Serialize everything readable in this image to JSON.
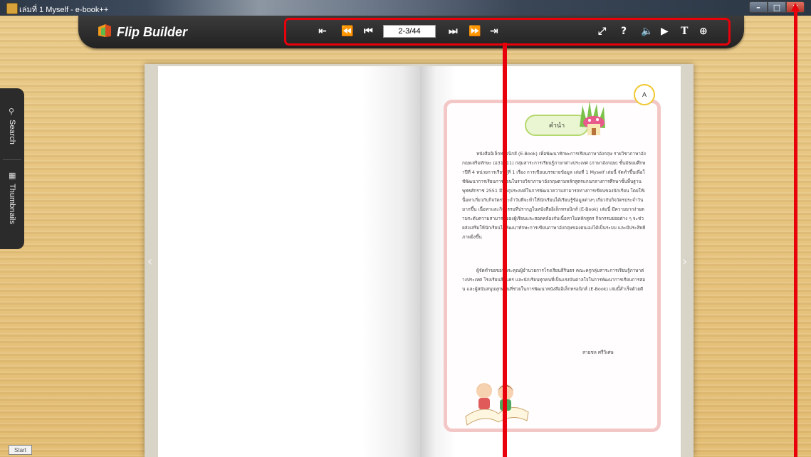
{
  "window": {
    "title": "เล่มที่ 1 Myself - e-book++",
    "minimize_label": "–",
    "maximize_label": "□",
    "close_label": "✕"
  },
  "toolbar": {
    "brand": "Flip Builder",
    "page_value": "2-3/44",
    "left_icons": [
      "first-page-icon",
      "previous-page-icon",
      "back-icon"
    ],
    "right_icons": [
      "forward-icon",
      "next-page-icon",
      "last-page-icon"
    ],
    "tool_icons": [
      "fullscreen-icon",
      "help-icon",
      "sound-icon",
      "autoplay-icon",
      "text-icon",
      "zoom-icon"
    ]
  },
  "side_tabs": {
    "search": "Search",
    "thumbnails": "Thumbnails"
  },
  "book": {
    "heading": "คำนำ",
    "badge": "A",
    "paragraph1": "หนังสืออิเล็กทรอนิกส์ (E-Book) เพื่อพัฒนาทักษะการเรียนภาษาอังกฤษ รายวิชาภาษาอังกฤษเสริมทักษะ (อ31211) กลุ่มสาระการเรียนรู้ภาษาต่างประเทศ (ภาษาอังกฤษ) ชั้นมัธยมศึกษาปีที่ 4 หน่วยการเรียนรู้ที่ 1 เรื่อง การเขียนบรรยายข้อมูล เล่มที่ 1 Myself เล่มนี้ จัดทำขึ้นเพื่อใช้พัฒนาการเรียนการสอนในรายวิชาภาษาอังกฤษตามหลักสูตรแกนกลางการศึกษาขั้นพื้นฐาน พุทธศักราช 2551 มีวัตถุประสงค์ในการพัฒนาความสามารถทางการเขียนของนักเรียน โดยให้เนื้อหาเกี่ยวกับกิจวัตรประจำวันที่จะทำให้นักเรียนได้เรียนรู้ข้อมูลต่างๆ เกี่ยวกับกิจวัตรประจำวันมากขึ้น เนื้อหาและกิจกรรมที่ปรากฏในหนังสืออิเล็กทรอนิกส์ (E-Book) เล่มนี้ มีความยากง่ายตามระดับความสามารถของผู้เรียนและสอดคล้องกับเนื้อหาในหลักสูตร กิจกรรมย่อยต่าง ๆ จะช่วยส่งเสริมให้นักเรียนได้พัฒนาทักษะการเขียนภาษาอังกฤษของตนเองได้เป็นระบบ และมีประสิทธิภาพยิ่งขึ้น",
    "paragraph2": "ผู้จัดทำขอขอบพระคุณผู้อำนวยการโรงเรียนสิรินธร คณะครูกลุ่มสาระการเรียนรู้ภาษาต่างประเทศ โรงเรียนสิรินธร และนักเรียนทุกคนที่เป็นแรงบันดาลใจในการพัฒนาการเรียนการสอน และผู้สนับสนุนทุกท่านที่ช่วยในการพัฒนาหนังสืออิเล็กทรอนิกส์ (E-Book) เล่มนี้สำเร็จด้วยดี",
    "signature": "สายชล ศรีวิเศษ"
  },
  "taskbar": {
    "start": "Start"
  },
  "colors": {
    "annotation_red": "#e8000b",
    "toolbar_bg": "#2a2a2a",
    "frame_pink": "#f4c7c7",
    "heading_green": "#b4d86e"
  }
}
